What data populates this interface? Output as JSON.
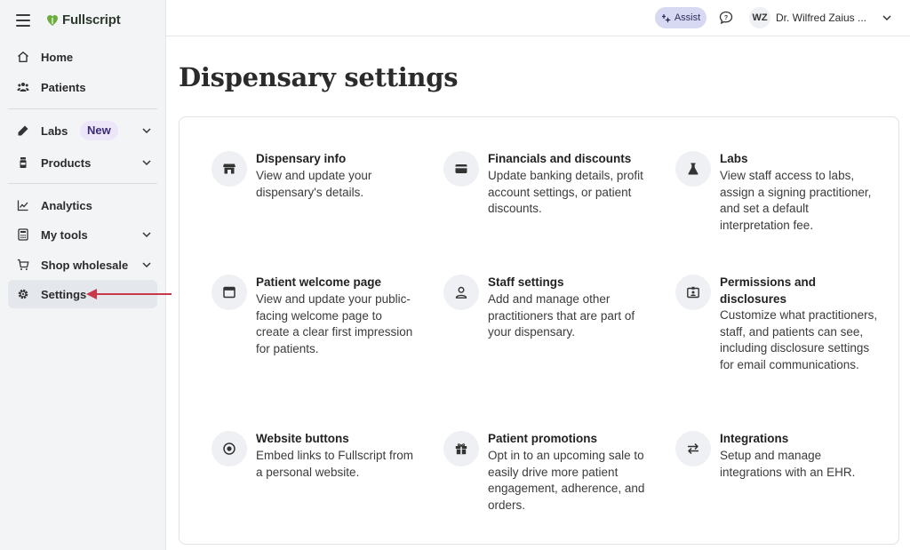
{
  "brand": {
    "name": "Fullscript"
  },
  "header": {
    "assist_label": "Assist",
    "user_initials": "WZ",
    "user_name": "Dr. Wilfred Zaius ..."
  },
  "sidebar": {
    "items": [
      {
        "label": "Home"
      },
      {
        "label": "Patients"
      },
      {
        "label": "Labs",
        "badge": "New"
      },
      {
        "label": "Products"
      },
      {
        "label": "Analytics"
      },
      {
        "label": "My tools"
      },
      {
        "label": "Shop wholesale"
      },
      {
        "label": "Settings"
      }
    ]
  },
  "page": {
    "title": "Dispensary settings"
  },
  "tiles": [
    {
      "title": "Dispensary info",
      "description": "View and update your dispensary's details.",
      "icon": "store-icon"
    },
    {
      "title": "Financials and discounts",
      "description": "Update banking details, profit account settings, or patient discounts.",
      "icon": "credit-card-icon"
    },
    {
      "title": "Labs",
      "description": "View staff access to labs, assign a signing practitioner, and set a default interpretation fee.",
      "icon": "flask-icon"
    },
    {
      "title": "Patient welcome page",
      "description": "View and update your public-facing welcome page to create a clear first impression for patients.",
      "icon": "browser-window-icon"
    },
    {
      "title": "Staff settings",
      "description": "Add and manage other practitioners that are part of your dispensary.",
      "icon": "person-icon"
    },
    {
      "title": "Permissions and disclosures",
      "description": "Customize what practitioners, staff, and patients can see, including disclosure settings for email communications.",
      "icon": "id-badge-icon"
    },
    {
      "title": "Website buttons",
      "description": "Embed links to Fullscript from a personal website.",
      "icon": "radio-button-icon"
    },
    {
      "title": "Patient promotions",
      "description": "Opt in to an upcoming sale to easily drive more patient engagement, adherence, and orders.",
      "icon": "gift-icon"
    },
    {
      "title": "Integrations",
      "description": "Setup and manage integrations with an EHR.",
      "icon": "swap-arrows-icon"
    }
  ],
  "colors": {
    "accent": "#3d2a78",
    "annotation_arrow": "#c8374a",
    "assist_bg": "#d7d9f3",
    "badge_bg": "#ece6f8"
  }
}
